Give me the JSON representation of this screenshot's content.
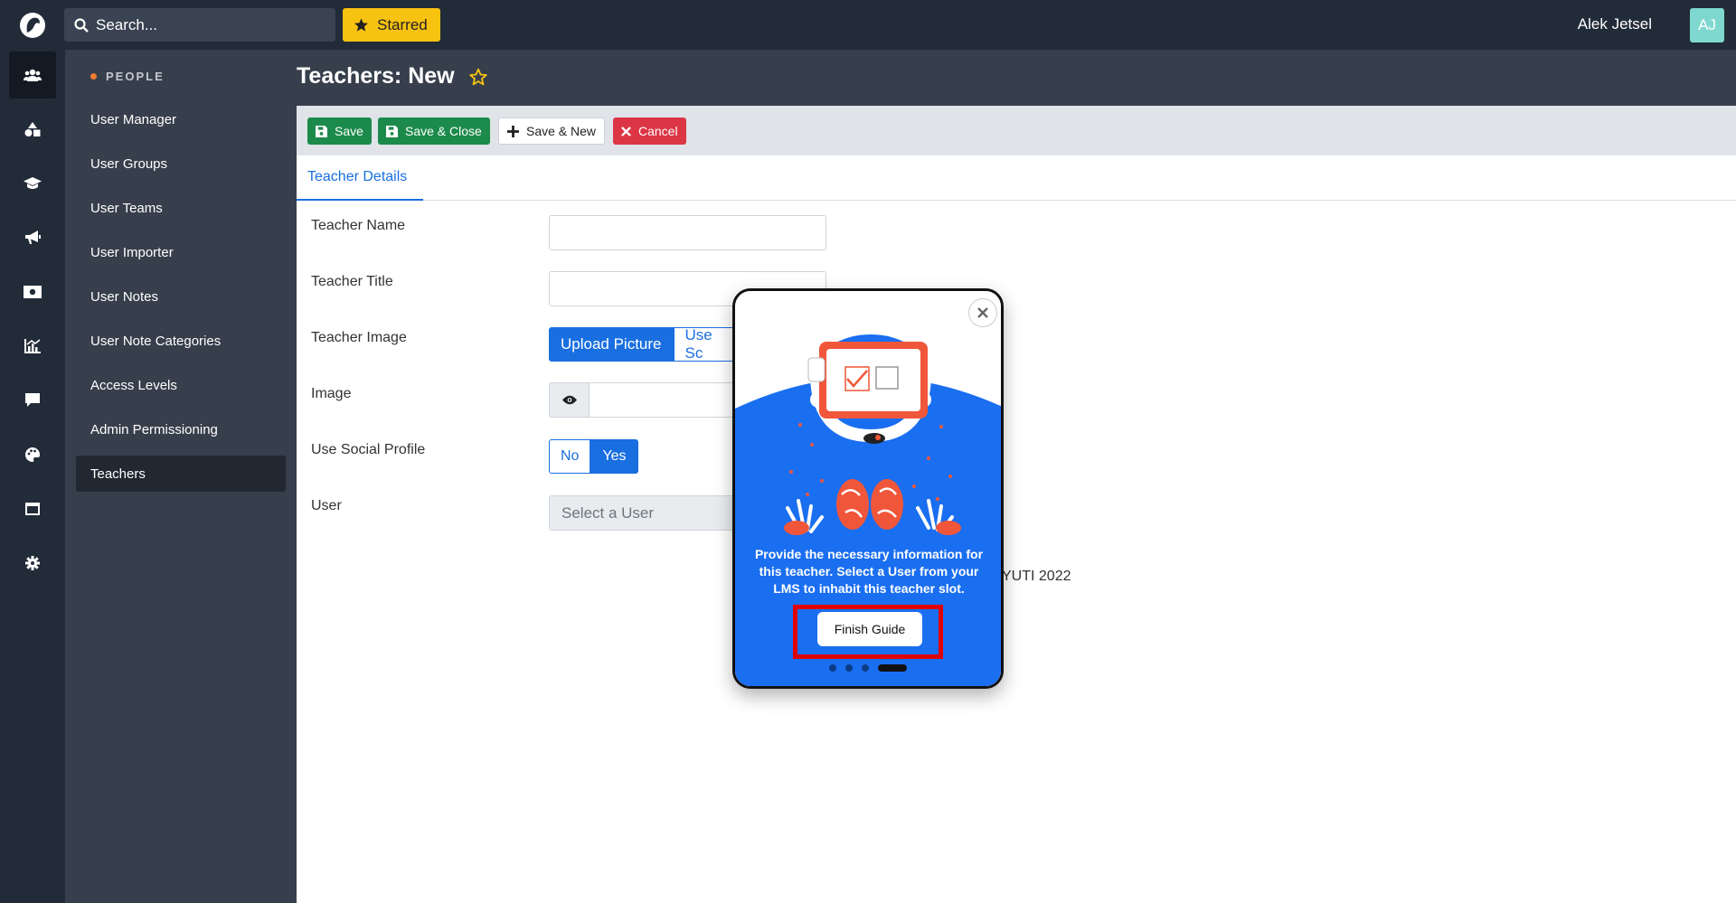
{
  "topbar": {
    "search_placeholder": "Search...",
    "starred_label": "Starred",
    "user_name": "Alek Jetsel",
    "avatar_initials": "AJ"
  },
  "rail": {
    "icons": [
      "users-icon",
      "shapes-icon",
      "graduation-cap-icon",
      "megaphone-icon",
      "money-icon",
      "chart-icon",
      "comment-icon",
      "palette-icon",
      "window-icon",
      "gear-icon"
    ],
    "active_index": 0
  },
  "sidebar": {
    "section_title": "PEOPLE",
    "items": [
      {
        "label": "User Manager"
      },
      {
        "label": "User Groups"
      },
      {
        "label": "User Teams"
      },
      {
        "label": "User Importer"
      },
      {
        "label": "User Notes"
      },
      {
        "label": "User Note Categories"
      },
      {
        "label": "Access Levels"
      },
      {
        "label": "Admin Permissioning"
      },
      {
        "label": "Teachers"
      }
    ],
    "active_index": 8
  },
  "page": {
    "title": "Teachers: New"
  },
  "toolbar": {
    "save_label": "Save",
    "save_close_label": "Save & Close",
    "save_new_label": "Save & New",
    "cancel_label": "Cancel"
  },
  "tabs": [
    {
      "label": "Teacher Details"
    }
  ],
  "form": {
    "teacher_name_label": "Teacher Name",
    "teacher_title_label": "Teacher Title",
    "teacher_image_label": "Teacher Image",
    "upload_picture_label": "Upload Picture",
    "use_social_label": "Use Sc",
    "image_label": "Image",
    "use_social_profile_label": "Use Social Profile",
    "no_label": "No",
    "yes_label": "Yes",
    "user_label": "User",
    "user_select_placeholder": "Select a User"
  },
  "footer": {
    "text": "YUTI 2022"
  },
  "guide": {
    "message": "Provide the necessary information for this teacher. Select a User from your LMS to inhabit this teacher slot.",
    "finish_label": "Finish Guide",
    "steps": 4,
    "current_step": 4
  },
  "colors": {
    "topbar": "#222b38",
    "sidebar": "#373f4c",
    "primary": "#1a6fe0",
    "success": "#1c8a4b",
    "danger": "#dc3545",
    "starred": "#f8c210",
    "highlight": "#e00000"
  }
}
